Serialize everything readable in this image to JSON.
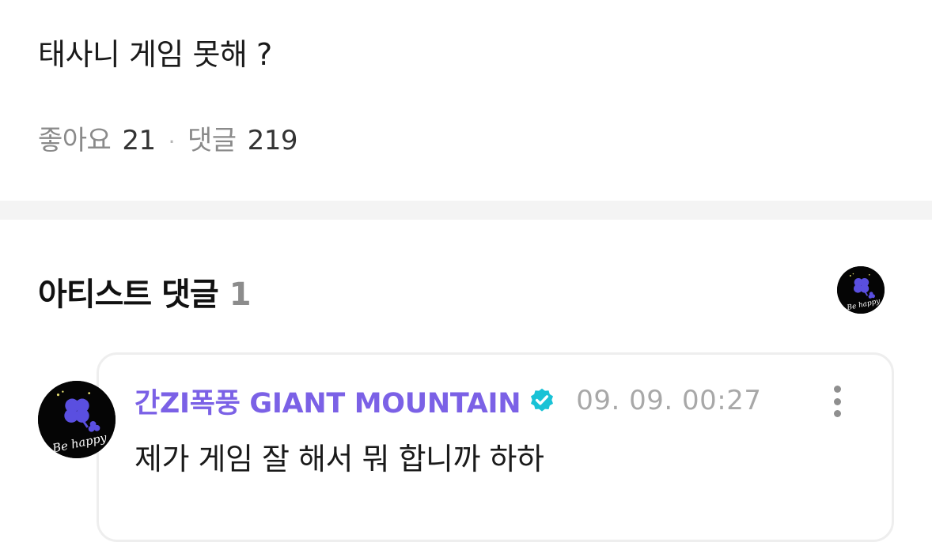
{
  "post": {
    "text": "태사니 게임 못해 ?",
    "likes_label": "좋아요",
    "likes_count": "21",
    "separator": "·",
    "comments_label": "댓글",
    "comments_count": "219"
  },
  "artist_comments": {
    "title": "아티스트 댓글",
    "count": "1",
    "avatar_text": "Be happy",
    "items": [
      {
        "author": "간ZI폭풍 GIANT MOUNTAIN",
        "verified_icon": "verified-badge-icon",
        "date": "09. 09. 00:27",
        "text": "제가 게임 잘 해서 뭐 합니까 하하",
        "avatar_text": "Be happy"
      }
    ]
  },
  "colors": {
    "author": "#7b61e6",
    "verified": "#19c2d6",
    "divider": "#f4f4f4",
    "avatar_bg": "#050505",
    "clover": "#5a4fe0"
  },
  "icons": {
    "more": "more-vertical-icon",
    "verified": "verified-badge-icon"
  }
}
